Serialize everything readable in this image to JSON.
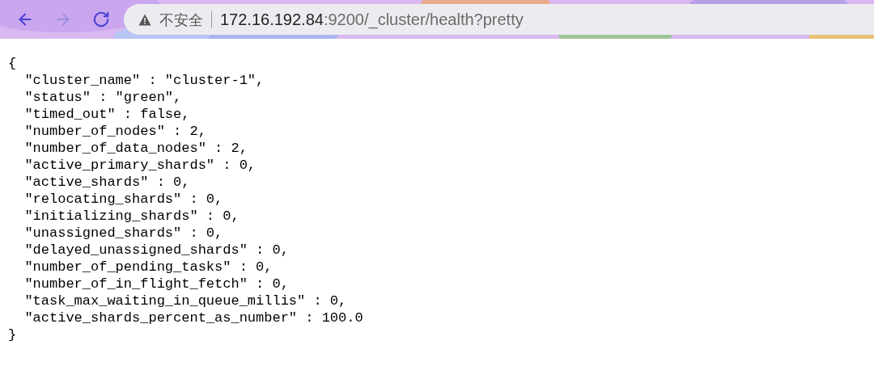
{
  "toolbar": {
    "buttons": [
      {
        "kind": "back",
        "disabled": false
      },
      {
        "kind": "forward",
        "disabled": true
      },
      {
        "kind": "reload",
        "disabled": false
      }
    ],
    "address_bar": {
      "security_label": "不安全",
      "host": "172.16.192.84",
      "path": ":9200/_cluster/health?pretty"
    }
  },
  "page": {
    "lines": [
      "{",
      "  \"cluster_name\" : \"cluster-1\",",
      "  \"status\" : \"green\",",
      "  \"timed_out\" : false,",
      "  \"number_of_nodes\" : 2,",
      "  \"number_of_data_nodes\" : 2,",
      "  \"active_primary_shards\" : 0,",
      "  \"active_shards\" : 0,",
      "  \"relocating_shards\" : 0,",
      "  \"initializing_shards\" : 0,",
      "  \"unassigned_shards\" : 0,",
      "  \"delayed_unassigned_shards\" : 0,",
      "  \"number_of_pending_tasks\" : 0,",
      "  \"number_of_in_flight_fetch\" : 0,",
      "  \"task_max_waiting_in_queue_millis\" : 0,",
      "  \"active_shards_percent_as_number\" : 100.0",
      "}"
    ]
  }
}
